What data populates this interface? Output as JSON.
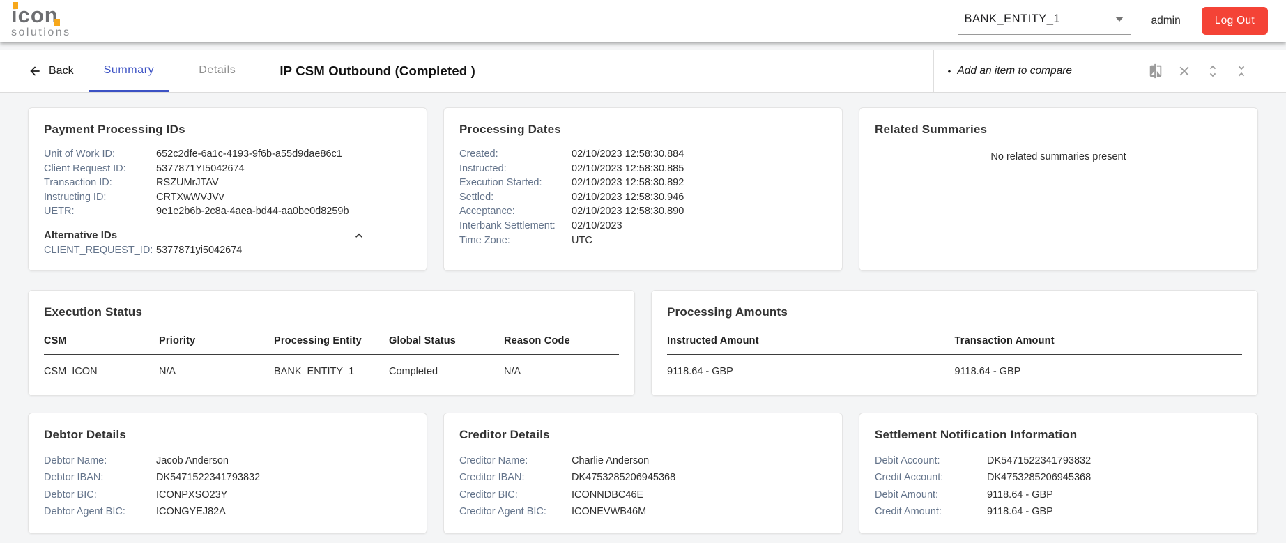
{
  "colors": {
    "accent_blue": "#3c52c4",
    "accent_red": "#f44336",
    "logo_gray": "#6d6e71",
    "logo_orange": "#f7a81b",
    "label_slate": "#64748b"
  },
  "header": {
    "logo_word": "icon",
    "logo_subtitle": "solutions",
    "entity_selected": "BANK_ENTITY_1",
    "username": "admin",
    "logout_label": "Log Out"
  },
  "toolbar": {
    "back_label": "Back",
    "tab_summary": "Summary",
    "tab_details": "Details",
    "page_title": "IP CSM Outbound (Completed )",
    "compare_bullet": "•",
    "compare_hint": "Add an item to compare",
    "icons": [
      "compare-icon",
      "close-icon",
      "expand-icon",
      "collapse-icon"
    ]
  },
  "cards": {
    "payment_ids": {
      "title": "Payment Processing IDs",
      "rows": [
        {
          "label": "Unit of Work ID:",
          "value": "652c2dfe-6a1c-4193-9f6b-a55d9dae86c1"
        },
        {
          "label": "Client Request ID:",
          "value": "5377871YI5042674"
        },
        {
          "label": "Transaction ID:",
          "value": "RSZUMrJTAV"
        },
        {
          "label": "Instructing ID:",
          "value": "CRTXwWVJVv"
        },
        {
          "label": "UETR:",
          "value": "9e1e2b6b-2c8a-4aea-bd44-aa0be0d8259b"
        }
      ],
      "alt_section": {
        "title": "Alternative IDs",
        "rows": [
          {
            "label": "CLIENT_REQUEST_ID:",
            "value": "5377871yi5042674"
          }
        ]
      }
    },
    "processing_dates": {
      "title": "Processing Dates",
      "rows": [
        {
          "label": "Created:",
          "value": "02/10/2023 12:58:30.884"
        },
        {
          "label": "Instructed:",
          "value": "02/10/2023 12:58:30.885"
        },
        {
          "label": "Execution Started:",
          "value": "02/10/2023 12:58:30.892"
        },
        {
          "label": "Settled:",
          "value": "02/10/2023 12:58:30.946"
        },
        {
          "label": "Acceptance:",
          "value": "02/10/2023 12:58:30.890"
        },
        {
          "label": "Interbank Settlement:",
          "value": "02/10/2023"
        },
        {
          "label": "Time Zone:",
          "value": "UTC"
        }
      ]
    },
    "related_summaries": {
      "title": "Related Summaries",
      "empty_message": "No related summaries present"
    },
    "execution_status": {
      "title": "Execution Status",
      "headers": [
        "CSM",
        "Priority",
        "Processing Entity",
        "Global Status",
        "Reason Code"
      ],
      "rows": [
        [
          "CSM_ICON",
          "N/A",
          "BANK_ENTITY_1",
          "Completed",
          "N/A"
        ]
      ]
    },
    "processing_amounts": {
      "title": "Processing Amounts",
      "headers": [
        "Instructed Amount",
        "Transaction Amount"
      ],
      "rows": [
        [
          "9118.64 - GBP",
          "9118.64 - GBP"
        ]
      ]
    },
    "debtor_details": {
      "title": "Debtor Details",
      "rows": [
        {
          "label": "Debtor Name:",
          "value": "Jacob Anderson"
        },
        {
          "label": "Debtor IBAN:",
          "value": "DK5471522341793832"
        },
        {
          "label": "Debtor BIC:",
          "value": "ICONPXSO23Y"
        },
        {
          "label": "Debtor Agent BIC:",
          "value": "ICONGYEJ82A"
        }
      ]
    },
    "creditor_details": {
      "title": "Creditor Details",
      "rows": [
        {
          "label": "Creditor Name:",
          "value": "Charlie Anderson"
        },
        {
          "label": "Creditor IBAN:",
          "value": "DK4753285206945368"
        },
        {
          "label": "Creditor BIC:",
          "value": "ICONNDBC46E"
        },
        {
          "label": "Creditor Agent BIC:",
          "value": "ICONEVWB46M"
        }
      ]
    },
    "settlement_info": {
      "title": "Settlement Notification Information",
      "rows": [
        {
          "label": "Debit Account:",
          "value": "DK5471522341793832"
        },
        {
          "label": "Credit Account:",
          "value": "DK4753285206945368"
        },
        {
          "label": "Debit Amount:",
          "value": "9118.64 - GBP"
        },
        {
          "label": "Credit Amount:",
          "value": "9118.64 - GBP"
        }
      ]
    }
  }
}
